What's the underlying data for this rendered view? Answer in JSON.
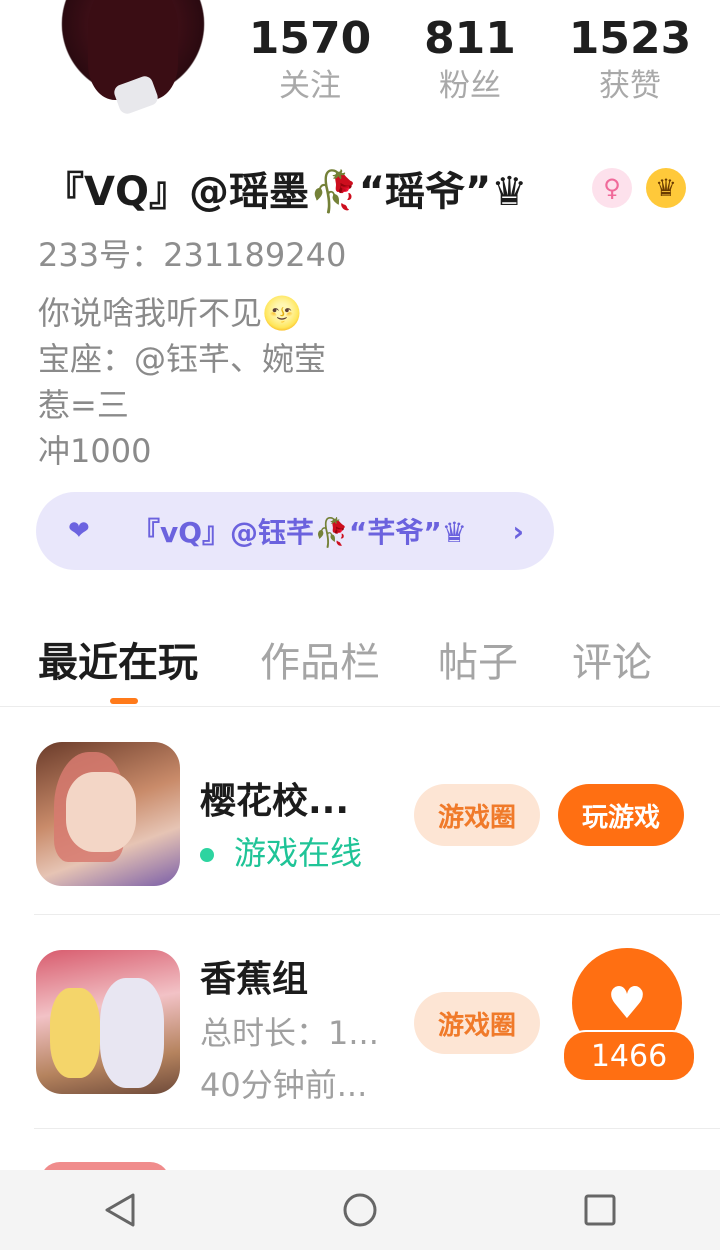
{
  "profile": {
    "stats": [
      {
        "value": "1570",
        "label": "关注"
      },
      {
        "value": "811",
        "label": "粉丝"
      },
      {
        "value": "1523",
        "label": "获赞"
      }
    ],
    "nickname": "『VQ』@瑶墨🥀“瑶爷”♛",
    "gender_icon": "♀",
    "crown_icon": "♛",
    "uid": "233号：231189240",
    "bio": [
      "你说啥我听不见🌝",
      "宝座：@钰芊、婉莹",
      "惹=三",
      "冲1000"
    ],
    "relation_label": "『vQ』@钰芊🥀“芊爷”♛",
    "relation_icon": "❤",
    "relation_chevron": "›"
  },
  "tabs": [
    {
      "label": "最近在玩",
      "active": true
    },
    {
      "label": "作品栏",
      "active": false
    },
    {
      "label": "帖子",
      "active": false
    },
    {
      "label": "评论",
      "active": false
    }
  ],
  "games": [
    {
      "title": "樱花校...",
      "status": "游戏在线",
      "circle_btn": "游戏圈",
      "play_btn": "玩游戏"
    },
    {
      "title": "香蕉组",
      "duration": "总时长：1...",
      "last_played": "40分钟前...",
      "circle_btn": "游戏圈"
    }
  ],
  "like_fab": {
    "icon": "♥",
    "count": "1466"
  },
  "navbar": {
    "back": "◁",
    "home": "○",
    "recent": "□"
  },
  "colors": {
    "accent": "#ff6f12",
    "online": "#1fc497",
    "relation_bg": "#e9e7fb"
  }
}
